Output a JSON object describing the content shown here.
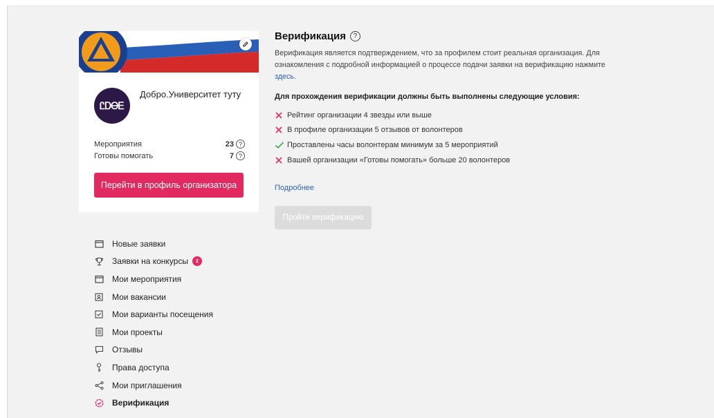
{
  "org": {
    "name": "Добро.Университет туту",
    "logo_text": "ᏝᎠᎾᎬ",
    "stats": [
      {
        "label": "Мероприятия",
        "value": "23"
      },
      {
        "label": "Готовы помогать",
        "value": "7"
      }
    ],
    "profile_button": "Перейти в профиль организатора"
  },
  "menu": {
    "items": [
      {
        "label": "Новые заявки",
        "icon": "calendar-icon"
      },
      {
        "label": "Заявки на конкурсы",
        "icon": "trophy-icon",
        "badge": "2"
      },
      {
        "label": "Мои мероприятия",
        "icon": "calendar-icon"
      },
      {
        "label": "Мои вакансии",
        "icon": "vacancy-icon"
      },
      {
        "label": "Мои варианты посещения",
        "icon": "checkbox-icon"
      },
      {
        "label": "Мои проекты",
        "icon": "document-icon"
      },
      {
        "label": "Отзывы",
        "icon": "comment-icon"
      },
      {
        "label": "Права доступа",
        "icon": "key-icon"
      },
      {
        "label": "Мои приглашения",
        "icon": "share-icon"
      },
      {
        "label": "Верификация",
        "icon": "verified-icon",
        "active": true
      }
    ]
  },
  "verification": {
    "title": "Верификация",
    "help_glyph": "?",
    "description": "Верификация является подтверждением, что за профилем стоит реальная организация. Для ознакомления с подробной информацией о процессе подачи заявки на верификацию нажмите",
    "link_text": "здесь.",
    "conditions_title": "Для прохождения верификации должны быть выполнены следующие условия:",
    "conditions": [
      {
        "text": "Рейтинг организации 4 звезды или выше",
        "met": false
      },
      {
        "text": "В профиле организации 5 отзывов от волонтеров",
        "met": false
      },
      {
        "text": "Проставлены часы волонтерам минимум за 5 мероприятий",
        "met": true
      },
      {
        "text": "Вашей организации «Готовы помогать» больше 20 волонтеров",
        "met": false
      }
    ],
    "more_link": "Подробнее",
    "verify_button": "Пройти верификацию"
  },
  "colors": {
    "accent": "#e22a60",
    "link": "#2f5fb3",
    "fail": "#e22a60",
    "success": "#2aa845",
    "background": "#f2f2f2",
    "logo_bg": "#2c1947"
  }
}
